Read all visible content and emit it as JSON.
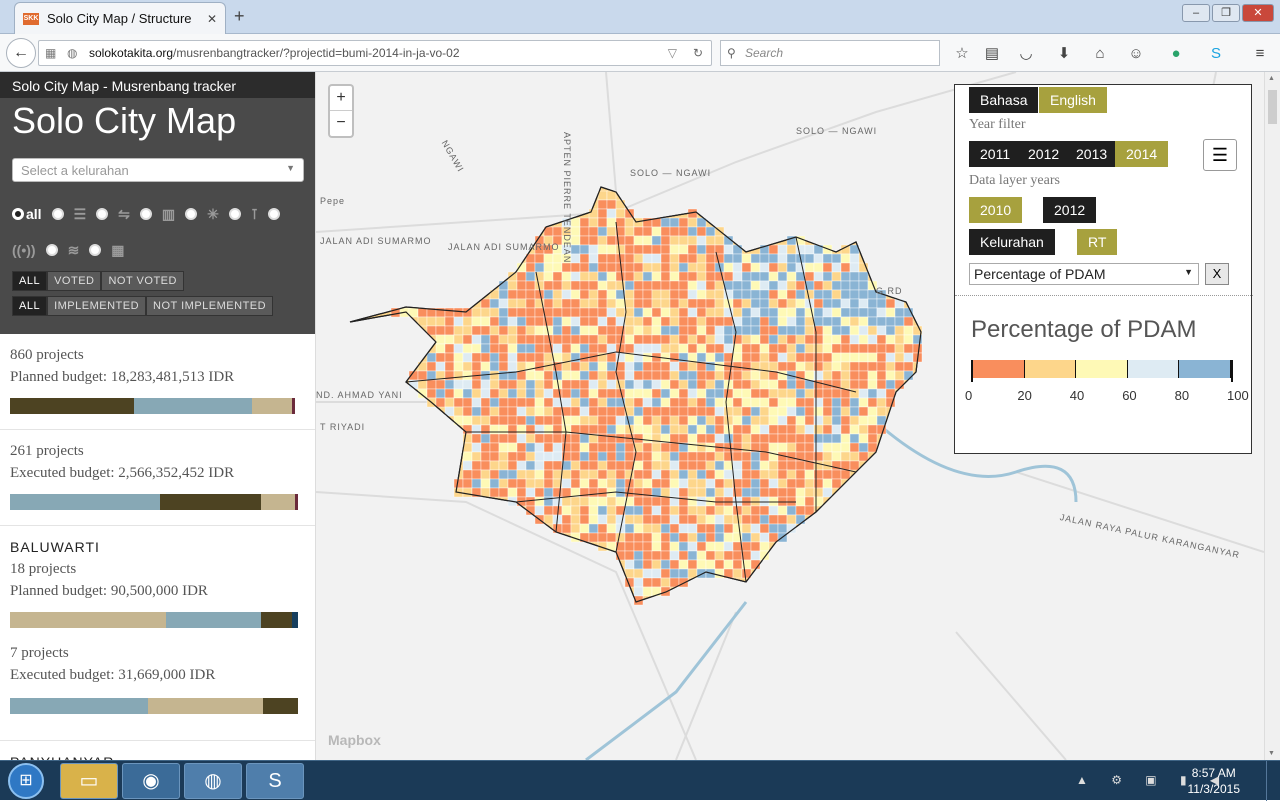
{
  "browser": {
    "tab_title": "Solo City Map / Structure",
    "tab_favicon": "SKK",
    "tab_close": "✕",
    "new_tab": "+",
    "url_host": "solokotakita.org",
    "url_path": "/musrenbangtracker/?projectid=bumi-2014-in-ja-vo-02",
    "search_placeholder": "Search"
  },
  "sidebar": {
    "subtitle": "Solo City Map - Musrenbang tracker",
    "title": "Solo City Map",
    "select_placeholder": "Select a kelurahan",
    "filter_all": "all",
    "vote_filter": [
      "ALL",
      "VOTED",
      "NOT VOTED"
    ],
    "impl_filter": [
      "ALL",
      "IMPLEMENTED",
      "NOT IMPLEMENTED"
    ],
    "summary": {
      "planned_count": "860 projects",
      "planned_budget": "Planned budget: 18,283,481,513 IDR",
      "executed_count": "261 projects",
      "executed_budget": "Executed budget: 2,566,352,452 IDR"
    },
    "kelurahan": [
      {
        "name": "BALUWARTI",
        "planned_count": "18 projects",
        "planned_budget": "Planned budget: 90,500,000 IDR",
        "executed_count": "7 projects",
        "executed_budget": "Executed budget: 31,669,000 IDR"
      },
      {
        "name": "PANYUANYAR"
      }
    ],
    "bar_colors": {
      "dark": "#4d4322",
      "blue": "#87a8b5",
      "tan": "#c5b590",
      "maroon": "#6b2a3b",
      "navy": "#163e5e"
    },
    "bars": {
      "total_planned": [
        0.43,
        0.41,
        0.14,
        0.01
      ],
      "total_executed": [
        0.52,
        0.35,
        0.12,
        0.01
      ],
      "kel_planned": [
        0.54,
        0.33,
        0.11,
        0.02
      ],
      "kel_executed": [
        0.48,
        0.4,
        0.12
      ]
    }
  },
  "map": {
    "zoom_in": "+",
    "zoom_out": "−",
    "attribution": "Mapbox",
    "street_labels": [
      "SOLO — NGAWI",
      "SOLO — NGAWI",
      "JALAN ADI SUMARMO",
      "JALAN ADI SUMARMO",
      "Pepe",
      "ND. AHMAD YANI",
      "T RIYADI",
      "JALAN RAYA PALUR KARANGANYAR",
      "APTEN PIERRE TENDEAN",
      "NGAWI",
      "G RD"
    ]
  },
  "panel": {
    "lang": [
      "Bahasa",
      "English"
    ],
    "year_filter_label": "Year filter",
    "years": [
      "2011",
      "2012",
      "2013",
      "2014"
    ],
    "data_layer_label": "Data layer years",
    "layer_years": [
      "2010",
      "2012"
    ],
    "levels": [
      "Kelurahan",
      "RT"
    ],
    "layer_select": "Percentage of PDAM",
    "close": "X",
    "legend_title": "Percentage of PDAM",
    "legend_ticks": [
      "0",
      "20",
      "40",
      "60",
      "80",
      "100"
    ],
    "legend_colors": [
      "#f98e5d",
      "#fdd68b",
      "#fef9b6",
      "#deebf3",
      "#8ab4d4"
    ]
  },
  "taskbar": {
    "time": "8:57 AM",
    "date": "11/3/2015"
  }
}
